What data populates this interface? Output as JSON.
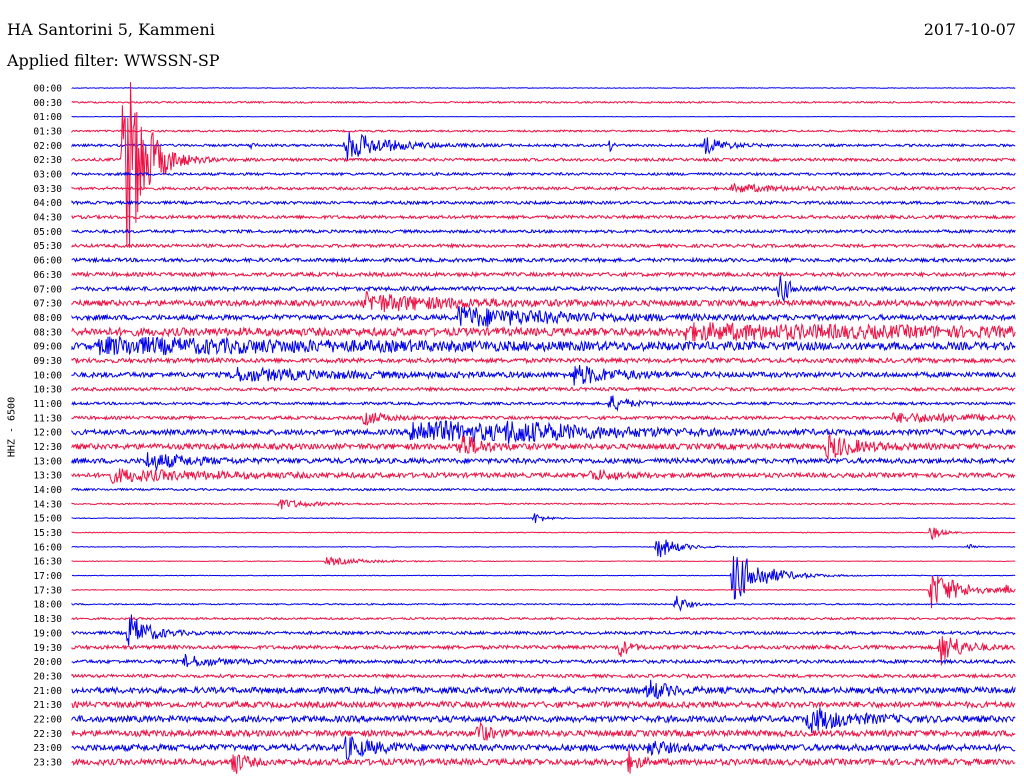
{
  "header": {
    "station": "HA Santorini 5, Kammeni",
    "date": "2017-10-07",
    "filter": "Applied filter: WWSSN-SP"
  },
  "chart_data": {
    "type": "line",
    "ylabel": "HHZ - 6500",
    "row_interval_minutes": 30,
    "row_labels": [
      "00:00",
      "00:30",
      "01:00",
      "01:30",
      "02:00",
      "02:30",
      "03:00",
      "03:30",
      "04:00",
      "04:30",
      "05:00",
      "05:30",
      "06:00",
      "06:30",
      "07:00",
      "07:30",
      "08:00",
      "08:30",
      "09:00",
      "09:30",
      "10:00",
      "10:30",
      "11:00",
      "11:30",
      "12:00",
      "12:30",
      "13:00",
      "13:30",
      "14:00",
      "14:30",
      "15:00",
      "15:30",
      "16:00",
      "16:30",
      "17:00",
      "17:30",
      "18:00",
      "18:30",
      "19:00",
      "19:30",
      "20:00",
      "20:30",
      "21:00",
      "21:30",
      "22:00",
      "22:30",
      "23:00",
      "23:30"
    ],
    "colors": [
      "#0000ee",
      "#ee1144"
    ],
    "base_noise": [
      0.3,
      0.8,
      0.2,
      0.9,
      1.2,
      1.4,
      1.3,
      1.4,
      1.5,
      1.6,
      1.5,
      1.6,
      1.8,
      1.9,
      2.0,
      2.8,
      2.5,
      4.0,
      3.5,
      2.2,
      2.5,
      1.6,
      1.3,
      1.6,
      2.6,
      2.8,
      2.5,
      2.2,
      1.0,
      0.7,
      0.4,
      0.4,
      0.3,
      0.3,
      0.3,
      0.4,
      0.7,
      1.0,
      1.5,
      1.8,
      1.7,
      1.6,
      3.0,
      2.9,
      3.1,
      3.0,
      3.2,
      3.0
    ],
    "events": [
      {
        "row": 4,
        "x": 0.29,
        "amp": 15,
        "dur": 0.04
      },
      {
        "row": 4,
        "x": 0.67,
        "amp": 9,
        "dur": 0.02
      },
      {
        "row": 4,
        "x": 0.57,
        "amp": 5,
        "dur": 0.004
      },
      {
        "row": 4,
        "x": 0.19,
        "amp": 3,
        "dur": 0.005
      },
      {
        "row": 7,
        "x": 0.7,
        "amp": 4,
        "dur": 0.05
      },
      {
        "row": 5,
        "x": 0.055,
        "amp": 120,
        "dur": 0.02
      },
      {
        "row": 14,
        "x": 0.75,
        "amp": 16,
        "dur": 0.01
      },
      {
        "row": 15,
        "x": 0.31,
        "amp": 9,
        "dur": 0.08
      },
      {
        "row": 16,
        "x": 0.41,
        "amp": 10,
        "dur": 0.1
      },
      {
        "row": 17,
        "x": 0.65,
        "amp": 6,
        "dur": 0.3
      },
      {
        "row": 18,
        "x": 0.03,
        "amp": 7,
        "dur": 0.3
      },
      {
        "row": 20,
        "x": 0.53,
        "amp": 10,
        "dur": 0.04
      },
      {
        "row": 20,
        "x": 0.17,
        "amp": 6,
        "dur": 0.1
      },
      {
        "row": 22,
        "x": 0.57,
        "amp": 8,
        "dur": 0.02
      },
      {
        "row": 23,
        "x": 0.31,
        "amp": 7,
        "dur": 0.02
      },
      {
        "row": 23,
        "x": 0.87,
        "amp": 4,
        "dur": 0.12
      },
      {
        "row": 24,
        "x": 0.36,
        "amp": 12,
        "dur": 0.12
      },
      {
        "row": 24,
        "x": 0.46,
        "amp": 6,
        "dur": 0.08
      },
      {
        "row": 25,
        "x": 0.41,
        "amp": 14,
        "dur": 0.02
      },
      {
        "row": 25,
        "x": 0.8,
        "amp": 12,
        "dur": 0.03
      },
      {
        "row": 26,
        "x": 0.08,
        "amp": 8,
        "dur": 0.04
      },
      {
        "row": 27,
        "x": 0.04,
        "amp": 6,
        "dur": 0.1
      },
      {
        "row": 27,
        "x": 0.55,
        "amp": 5,
        "dur": 0.03
      },
      {
        "row": 29,
        "x": 0.22,
        "amp": 5,
        "dur": 0.03
      },
      {
        "row": 30,
        "x": 0.49,
        "amp": 6,
        "dur": 0.01
      },
      {
        "row": 31,
        "x": 0.91,
        "amp": 8,
        "dur": 0.01
      },
      {
        "row": 32,
        "x": 0.62,
        "amp": 12,
        "dur": 0.02
      },
      {
        "row": 32,
        "x": 0.95,
        "amp": 5,
        "dur": 0.005
      },
      {
        "row": 33,
        "x": 0.27,
        "amp": 4,
        "dur": 0.04
      },
      {
        "row": 34,
        "x": 0.7,
        "amp": 28,
        "dur": 0.03
      },
      {
        "row": 35,
        "x": 0.91,
        "amp": 20,
        "dur": 0.03
      },
      {
        "row": 35,
        "x": 0.99,
        "amp": 4,
        "dur": 0.01
      },
      {
        "row": 36,
        "x": 0.64,
        "amp": 10,
        "dur": 0.01
      },
      {
        "row": 38,
        "x": 0.06,
        "amp": 20,
        "dur": 0.02
      },
      {
        "row": 39,
        "x": 0.58,
        "amp": 10,
        "dur": 0.01
      },
      {
        "row": 39,
        "x": 0.92,
        "amp": 18,
        "dur": 0.02
      },
      {
        "row": 40,
        "x": 0.12,
        "amp": 6,
        "dur": 0.03
      },
      {
        "row": 42,
        "x": 0.61,
        "amp": 10,
        "dur": 0.02
      },
      {
        "row": 44,
        "x": 0.78,
        "amp": 12,
        "dur": 0.04
      },
      {
        "row": 45,
        "x": 0.43,
        "amp": 12,
        "dur": 0.01
      },
      {
        "row": 46,
        "x": 0.29,
        "amp": 10,
        "dur": 0.03
      },
      {
        "row": 46,
        "x": 0.61,
        "amp": 7,
        "dur": 0.02
      },
      {
        "row": 47,
        "x": 0.17,
        "amp": 14,
        "dur": 0.01
      },
      {
        "row": 47,
        "x": 0.59,
        "amp": 10,
        "dur": 0.01
      }
    ]
  }
}
